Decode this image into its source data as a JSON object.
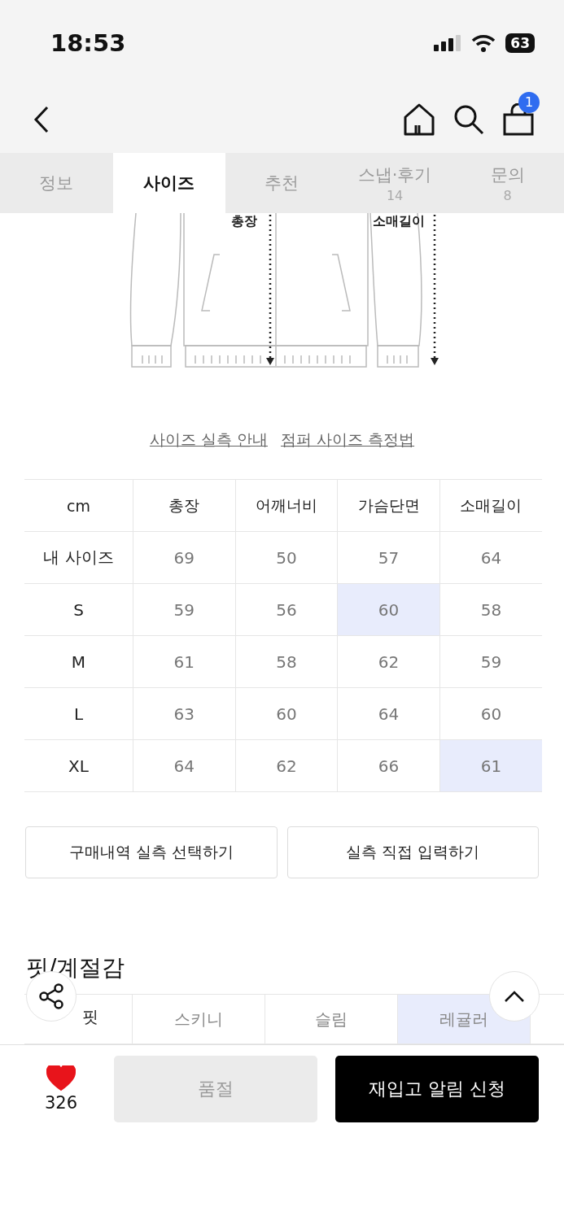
{
  "status_bar": {
    "time": "18:53",
    "battery": "63"
  },
  "nav": {
    "cart_badge": "1"
  },
  "tabs": [
    {
      "label": "정보",
      "selected": false
    },
    {
      "label": "사이즈",
      "selected": true
    },
    {
      "label": "추천",
      "selected": false
    },
    {
      "label": "스냅·후기",
      "count": "14",
      "selected": false
    },
    {
      "label": "문의",
      "count": "8",
      "selected": false
    }
  ],
  "diagram": {
    "labels": [
      "총장",
      "소매길이"
    ]
  },
  "guide_links": [
    "사이즈 실측 안내",
    "점퍼 사이즈 측정법"
  ],
  "size_table": {
    "columns": [
      "cm",
      "총장",
      "어깨너비",
      "가슴단면",
      "소매길이"
    ],
    "rows": [
      {
        "cells": [
          {
            "value": "내 사이즈",
            "highlighted": false
          },
          {
            "value": "69",
            "highlighted": false
          },
          {
            "value": "50",
            "highlighted": false
          },
          {
            "value": "57",
            "highlighted": false
          },
          {
            "value": "64",
            "highlighted": false
          }
        ]
      },
      {
        "cells": [
          {
            "value": "S",
            "highlighted": false
          },
          {
            "value": "59",
            "highlighted": false
          },
          {
            "value": "56",
            "highlighted": false
          },
          {
            "value": "60",
            "highlighted": true
          },
          {
            "value": "58",
            "highlighted": false
          }
        ]
      },
      {
        "cells": [
          {
            "value": "M",
            "highlighted": false
          },
          {
            "value": "61",
            "highlighted": false
          },
          {
            "value": "58",
            "highlighted": false
          },
          {
            "value": "62",
            "highlighted": false
          },
          {
            "value": "59",
            "highlighted": false
          }
        ]
      },
      {
        "cells": [
          {
            "value": "L",
            "highlighted": false
          },
          {
            "value": "63",
            "highlighted": false
          },
          {
            "value": "60",
            "highlighted": false
          },
          {
            "value": "64",
            "highlighted": false
          },
          {
            "value": "60",
            "highlighted": false
          }
        ]
      },
      {
        "cells": [
          {
            "value": "XL",
            "highlighted": false
          },
          {
            "value": "64",
            "highlighted": false
          },
          {
            "value": "62",
            "highlighted": false
          },
          {
            "value": "66",
            "highlighted": false
          },
          {
            "value": "61",
            "highlighted": true
          }
        ]
      }
    ]
  },
  "size_buttons": [
    "구매내역 실측 선택하기",
    "실측 직접 입력하기"
  ],
  "fit_section": {
    "title": "핏/계절감",
    "row_label": "핏",
    "options": [
      {
        "label": "스키니",
        "selected": false
      },
      {
        "label": "슬림",
        "selected": false
      },
      {
        "label": "레귤러",
        "selected": true
      }
    ]
  },
  "bottom_bar": {
    "liked": true,
    "like_count": "326",
    "sold_out_button": {
      "label": "품절",
      "disabled": true
    },
    "restock_button": "재입고 알림 신청"
  }
}
